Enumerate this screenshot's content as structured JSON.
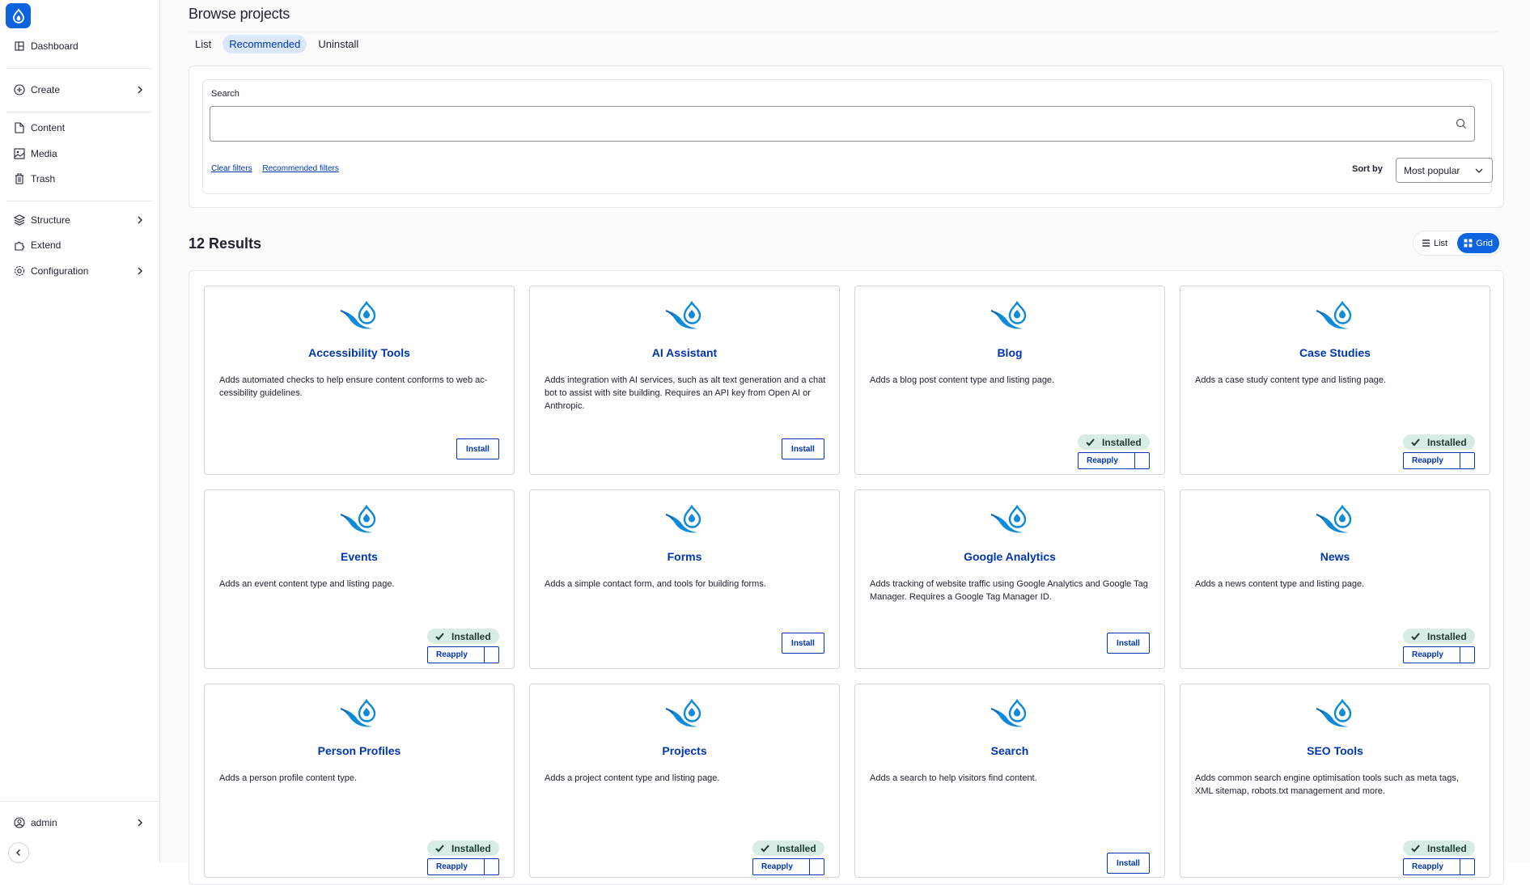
{
  "sidebar": {
    "items": [
      {
        "label": "Dashboard",
        "icon": "dashboard-icon"
      },
      {
        "label": "Create",
        "icon": "plus-circle-icon"
      },
      {
        "label": "Content",
        "icon": "document-icon"
      },
      {
        "label": "Media",
        "icon": "image-icon"
      },
      {
        "label": "Trash",
        "icon": "trash-icon"
      },
      {
        "label": "Structure",
        "icon": "layers-icon"
      },
      {
        "label": "Extend",
        "icon": "puzzle-icon"
      },
      {
        "label": "Configuration",
        "icon": "gear-icon"
      }
    ],
    "user": {
      "label": "admin",
      "icon": "user-circle-icon"
    }
  },
  "header": {
    "title": "Browse projects",
    "tabs": [
      {
        "label": "List"
      },
      {
        "label": "Recommended"
      },
      {
        "label": "Uninstall"
      }
    ]
  },
  "filters": {
    "search_label": "Search",
    "search_value": "",
    "clear_filters": "Clear filters",
    "recommended_filters": "Recommended filters",
    "sort_label": "Sort by",
    "sort_value": "Most popular"
  },
  "results": {
    "heading": "12 Results",
    "view_list": "List",
    "view_grid": "Grid"
  },
  "labels": {
    "install": "Install",
    "installed": "Installed",
    "reapply": "Reapply"
  },
  "colors": {
    "accent": "#0e63df",
    "link": "#0036b1",
    "installed_bg": "#d7ece3"
  },
  "cards": [
    {
      "title": "Accessibility Tools",
      "description": "Adds automated checks to help ensure content conforms to web ac­cessibility guidelines.",
      "installed": false
    },
    {
      "title": "AI Assistant",
      "description": "Adds integration with AI services, such as alt text generation and a chat bot to assist with site building. Requires an API key from Open AI or Anthropic.",
      "installed": false
    },
    {
      "title": "Blog",
      "description": "Adds a blog post content type and listing page.",
      "installed": true
    },
    {
      "title": "Case Studies",
      "description": "Adds a case study content type and listing page.",
      "installed": true
    },
    {
      "title": "Events",
      "description": "Adds an event content type and listing page.",
      "installed": true
    },
    {
      "title": "Forms",
      "description": "Adds a simple contact form, and tools for building forms.",
      "installed": false
    },
    {
      "title": "Google Analytics",
      "description": "Adds tracking of website traffic using Google Analytics and Google Tag Manager. Requires a Google Tag Manager ID.",
      "installed": false
    },
    {
      "title": "News",
      "description": "Adds a news content type and listing page.",
      "installed": true
    },
    {
      "title": "Person Profiles",
      "description": "Adds a person profile content type.",
      "installed": true
    },
    {
      "title": "Projects",
      "description": "Adds a project content type and listing page.",
      "installed": true
    },
    {
      "title": "Search",
      "description": "Adds a search to help visitors find content.",
      "installed": false
    },
    {
      "title": "SEO Tools",
      "description": "Adds common search engine optimisation tools such as meta tags, XML sitemap, robots.txt management and more.",
      "installed": true
    }
  ]
}
